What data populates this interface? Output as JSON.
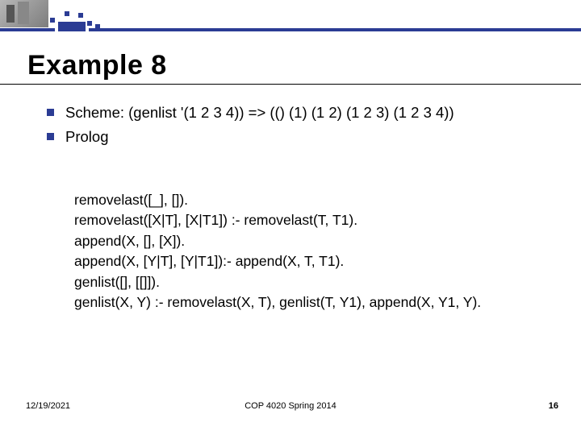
{
  "title": "Example 8",
  "bullets": [
    "Scheme: (genlist '(1 2 3 4)) => (() (1) (1 2) (1 2 3) (1 2 3 4))",
    "Prolog"
  ],
  "code": [
    "removelast([_], []).",
    "removelast([X|T], [X|T1]) :- removelast(T, T1).",
    "append(X, [], [X]).",
    "append(X, [Y|T], [Y|T1]):- append(X, T, T1).",
    "genlist([], [[]]).",
    "genlist(X, Y) :- removelast(X, T), genlist(T, Y1), append(X, Y1, Y)."
  ],
  "footer": {
    "date": "12/19/2021",
    "course": "COP 4020 Spring 2014",
    "page": "16"
  }
}
